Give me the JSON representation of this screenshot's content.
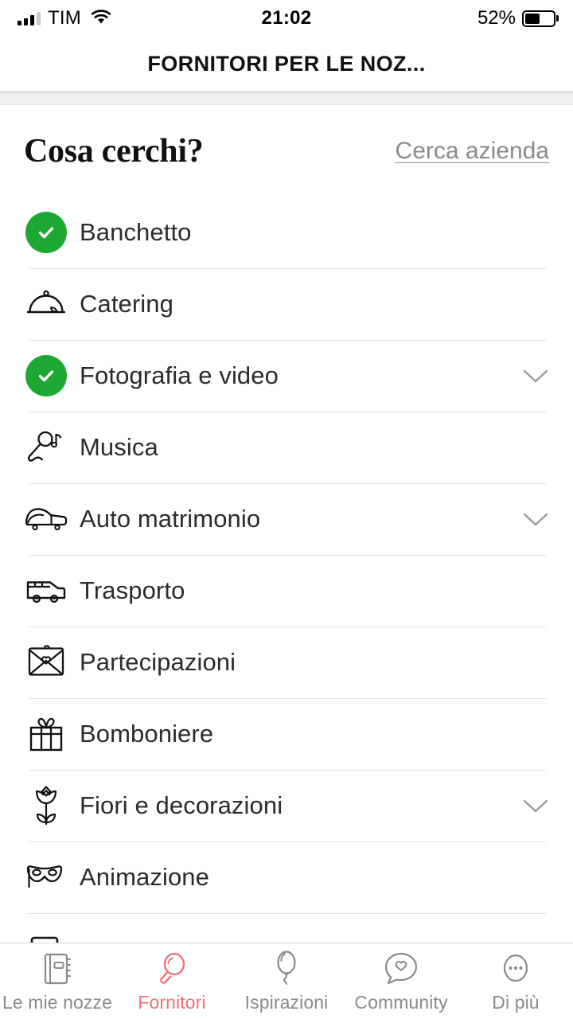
{
  "status_bar": {
    "carrier": "TIM",
    "signal_icon": "signal-bars-icon",
    "wifi_icon": "wifi-icon",
    "time": "21:02",
    "battery_percent": "52%",
    "battery_icon": "battery-icon",
    "battery_level": 52
  },
  "header": {
    "title": "FORNITORI PER LE NOZ..."
  },
  "search": {
    "title": "Cosa cerchi?",
    "link_label": "Cerca azienda"
  },
  "colors": {
    "check_green": "#1ca833",
    "active_tab": "#f0707c",
    "inactive_tab": "#8a8a8e",
    "divider": "#e3e3e3",
    "text": "#2b2b2b"
  },
  "categories": [
    {
      "label": "Banchetto",
      "icon": "check-circle-icon",
      "selected": true,
      "expandable": false
    },
    {
      "label": "Catering",
      "icon": "cloche-icon",
      "selected": false,
      "expandable": false
    },
    {
      "label": "Fotografia e video",
      "icon": "check-circle-icon",
      "selected": true,
      "expandable": true
    },
    {
      "label": "Musica",
      "icon": "microphone-icon",
      "selected": false,
      "expandable": false
    },
    {
      "label": "Auto matrimonio",
      "icon": "car-icon",
      "selected": false,
      "expandable": true
    },
    {
      "label": "Trasporto",
      "icon": "van-icon",
      "selected": false,
      "expandable": false
    },
    {
      "label": "Partecipazioni",
      "icon": "envelope-heart-icon",
      "selected": false,
      "expandable": false
    },
    {
      "label": "Bomboniere",
      "icon": "gift-icon",
      "selected": false,
      "expandable": false
    },
    {
      "label": "Fiori e decorazioni",
      "icon": "tulip-icon",
      "selected": false,
      "expandable": true
    },
    {
      "label": "Animazione",
      "icon": "mask-icon",
      "selected": false,
      "expandable": false
    }
  ],
  "tabs": [
    {
      "label": "Le mie nozze",
      "icon": "planner-book-icon",
      "active": false
    },
    {
      "label": "Fornitori",
      "icon": "magnifier-icon",
      "active": true
    },
    {
      "label": "Ispirazioni",
      "icon": "balloon-icon",
      "active": false
    },
    {
      "label": "Community",
      "icon": "speech-heart-icon",
      "active": false
    },
    {
      "label": "Di più",
      "icon": "ellipsis-circle-icon",
      "active": false
    }
  ]
}
